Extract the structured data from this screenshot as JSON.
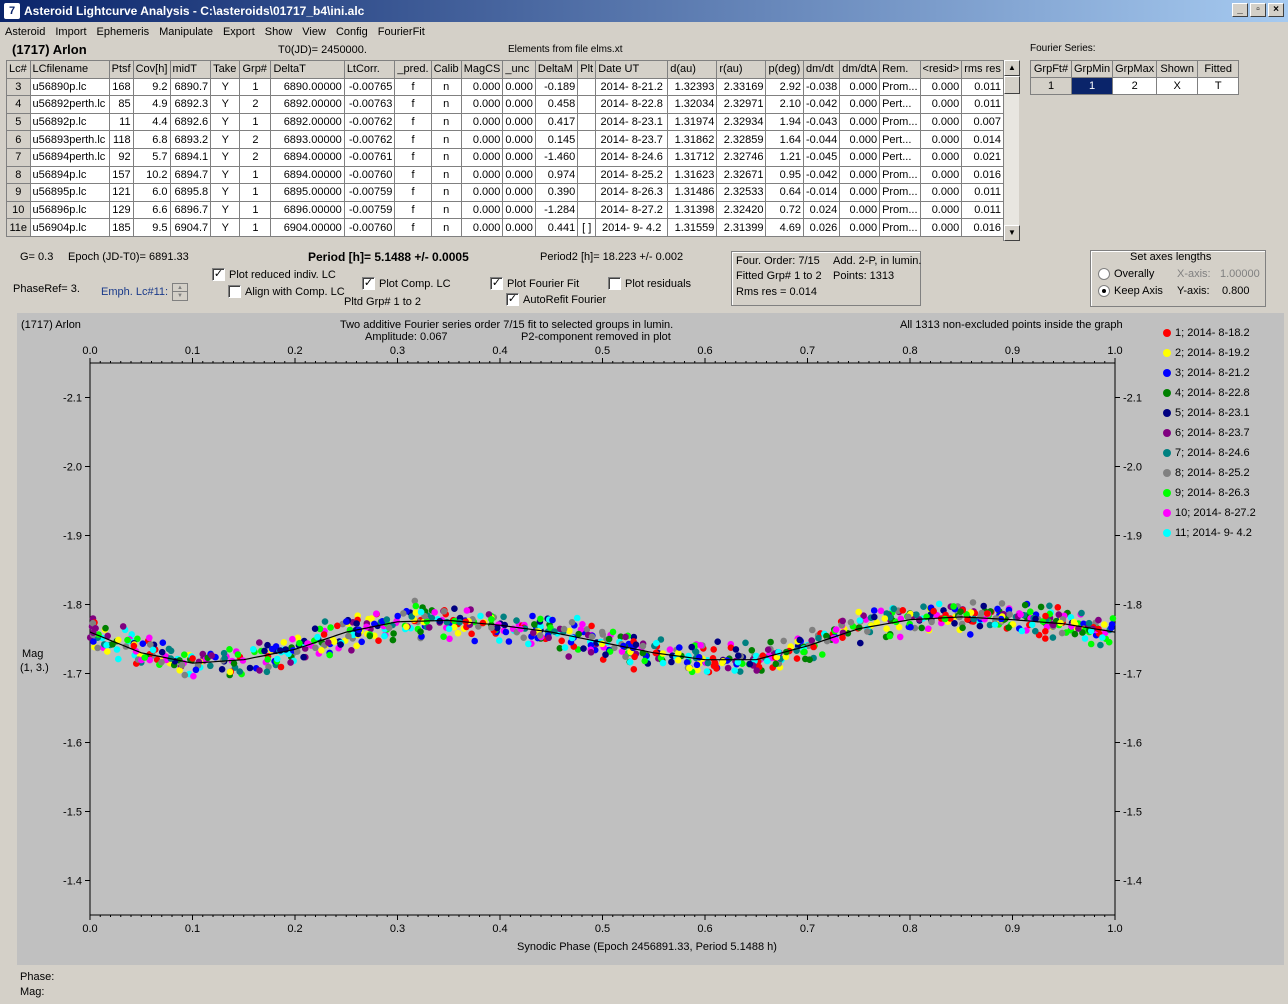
{
  "window": {
    "title": "Asteroid Lightcurve Analysis - C:\\asteroids\\01717_b4\\ini.alc",
    "icon_letter": "7"
  },
  "menu": [
    "Asteroid",
    "Import",
    "Ephemeris",
    "Manipulate",
    "Export",
    "Show",
    "View",
    "Config",
    "FourierFit"
  ],
  "header": {
    "asteroid": "(1717) Arlon",
    "t0": "T0(JD)= 2450000.",
    "elements": "Elements from file elms.xt",
    "fourier_title": "Fourier Series:"
  },
  "table": {
    "columns": [
      "Lc#",
      "LCfilename",
      "Ptsf",
      "Cov[h]",
      "midT",
      "Take",
      "Grp#",
      "DeltaT",
      "LtCorr.",
      "_pred.",
      "Calib",
      "MagCS",
      "_unc",
      "DeltaM",
      "Plt",
      "Date UT",
      "d(au)",
      "r(au)",
      "p(deg)",
      "dm/dt",
      "dm/dtA",
      "Rem.",
      "<resid>",
      "rms res"
    ],
    "rows": [
      [
        "3",
        "u56890p.lc",
        "168",
        "9.2",
        "6890.7",
        "Y",
        "1",
        "6890.00000",
        "-0.00765",
        "f",
        "n",
        "0.000",
        "0.000",
        "-0.189",
        "",
        "2014- 8-21.2",
        "1.32393",
        "2.33169",
        "2.92",
        "-0.038",
        "0.000",
        "Prom...",
        "0.000",
        "0.011"
      ],
      [
        "4",
        "u56892perth.lc",
        "85",
        "4.9",
        "6892.3",
        "Y",
        "2",
        "6892.00000",
        "-0.00763",
        "f",
        "n",
        "0.000",
        "0.000",
        "0.458",
        "",
        "2014- 8-22.8",
        "1.32034",
        "2.32971",
        "2.10",
        "-0.042",
        "0.000",
        "Pert...",
        "0.000",
        "0.011"
      ],
      [
        "5",
        "u56892p.lc",
        "11",
        "4.4",
        "6892.6",
        "Y",
        "1",
        "6892.00000",
        "-0.00762",
        "f",
        "n",
        "0.000",
        "0.000",
        "0.417",
        "",
        "2014- 8-23.1",
        "1.31974",
        "2.32934",
        "1.94",
        "-0.043",
        "0.000",
        "Prom...",
        "0.000",
        "0.007"
      ],
      [
        "6",
        "u56893perth.lc",
        "118",
        "6.8",
        "6893.2",
        "Y",
        "2",
        "6893.00000",
        "-0.00762",
        "f",
        "n",
        "0.000",
        "0.000",
        "0.145",
        "",
        "2014- 8-23.7",
        "1.31862",
        "2.32859",
        "1.64",
        "-0.044",
        "0.000",
        "Pert...",
        "0.000",
        "0.014"
      ],
      [
        "7",
        "u56894perth.lc",
        "92",
        "5.7",
        "6894.1",
        "Y",
        "2",
        "6894.00000",
        "-0.00761",
        "f",
        "n",
        "0.000",
        "0.000",
        "-1.460",
        "",
        "2014- 8-24.6",
        "1.31712",
        "2.32746",
        "1.21",
        "-0.045",
        "0.000",
        "Pert...",
        "0.000",
        "0.021"
      ],
      [
        "8",
        "u56894p.lc",
        "157",
        "10.2",
        "6894.7",
        "Y",
        "1",
        "6894.00000",
        "-0.00760",
        "f",
        "n",
        "0.000",
        "0.000",
        "0.974",
        "",
        "2014- 8-25.2",
        "1.31623",
        "2.32671",
        "0.95",
        "-0.042",
        "0.000",
        "Prom...",
        "0.000",
        "0.016"
      ],
      [
        "9",
        "u56895p.lc",
        "121",
        "6.0",
        "6895.8",
        "Y",
        "1",
        "6895.00000",
        "-0.00759",
        "f",
        "n",
        "0.000",
        "0.000",
        "0.390",
        "",
        "2014- 8-26.3",
        "1.31486",
        "2.32533",
        "0.64",
        "-0.014",
        "0.000",
        "Prom...",
        "0.000",
        "0.011"
      ],
      [
        "10",
        "u56896p.lc",
        "129",
        "6.6",
        "6896.7",
        "Y",
        "1",
        "6896.00000",
        "-0.00759",
        "f",
        "n",
        "0.000",
        "0.000",
        "-1.284",
        "",
        "2014- 8-27.2",
        "1.31398",
        "2.32420",
        "0.72",
        "0.024",
        "0.000",
        "Prom...",
        "0.000",
        "0.011"
      ],
      [
        "11e",
        "u56904p.lc",
        "185",
        "9.5",
        "6904.7",
        "Y",
        "1",
        "6904.00000",
        "-0.00760",
        "f",
        "n",
        "0.000",
        "0.000",
        "0.441",
        "[ ]",
        "2014- 9- 4.2",
        "1.31559",
        "2.31399",
        "4.69",
        "0.026",
        "0.000",
        "Prom...",
        "0.000",
        "0.016"
      ]
    ]
  },
  "fourier_table": {
    "columns": [
      "GrpFt#",
      "GrpMin",
      "GrpMax",
      "Shown",
      "Fitted"
    ],
    "row": [
      "1",
      "1",
      "2",
      "X",
      "T"
    ]
  },
  "controls": {
    "g": "G= 0.3",
    "epoch": "Epoch (JD-T0)= 6891.33",
    "period": "Period [h]= 5.1488 +/- 0.0005",
    "period2": "Period2 [h]= 18.223 +/- 0.002",
    "phaseref": "PhaseRef= 3.",
    "emph": "Emph. Lc#11:",
    "plot_reduced": "Plot reduced indiv. LC",
    "align_comp": "Align with Comp. LC",
    "plot_comp": "Plot Comp. LC",
    "pltd_grp": "Pltd Grp#  1   to   2",
    "plot_fourier": "Plot Fourier Fit",
    "autorefit": "AutoRefit Fourier",
    "plot_residuals": "Plot residuals",
    "info_order": "Four. Order:  7/15",
    "info_add": "Add. 2-P, in lumin.",
    "info_fitted": "Fitted Grp# 1 to 2",
    "info_points": "Points: 1313",
    "info_rms": "Rms res     = 0.014",
    "axes_title": "Set axes lengths",
    "overally": "Overally",
    "keep_axis": "Keep Axis",
    "xaxis_label": "X-axis:",
    "xaxis_val": "1.00000",
    "yaxis_label": "Y-axis:",
    "yaxis_val": "0.800"
  },
  "status": {
    "phase": "Phase:",
    "mag": "Mag:"
  },
  "chart_data": {
    "type": "scatter",
    "object_label": "(1717) Arlon",
    "title": "Two additive Fourier series order 7/15 fit to selected groups in lumin.",
    "amplitude": "Amplitude: 0.067",
    "p2_note": "P2-component removed in plot",
    "points_note": "All 1313 non-excluded points inside the graph",
    "xlabel": "Synodic Phase (Epoch 2456891.33, Period 5.1488 h)",
    "ylabel": "Mag",
    "ylabel2": "(1, 3.)",
    "xlim": [
      0.0,
      1.0
    ],
    "ylim": [
      -2.15,
      -1.35
    ],
    "y_inverted": true,
    "x_ticks": [
      "0.0",
      "0.1",
      "0.2",
      "0.3",
      "0.4",
      "0.5",
      "0.6",
      "0.7",
      "0.8",
      "0.9",
      "1.0"
    ],
    "y_ticks": [
      "-2.1",
      "-2.0",
      "-1.9",
      "-1.8",
      "-1.7",
      "-1.6",
      "-1.5",
      "-1.4"
    ],
    "y_tick_values": [
      -2.1,
      -2.0,
      -1.9,
      -1.8,
      -1.7,
      -1.6,
      -1.5,
      -1.4
    ],
    "fit_curve": {
      "x": [
        0.0,
        0.05,
        0.1,
        0.15,
        0.2,
        0.25,
        0.3,
        0.35,
        0.4,
        0.45,
        0.5,
        0.55,
        0.6,
        0.65,
        0.7,
        0.75,
        0.8,
        0.85,
        0.9,
        0.95,
        1.0
      ],
      "y": [
        -1.76,
        -1.73,
        -1.715,
        -1.72,
        -1.735,
        -1.76,
        -1.775,
        -1.777,
        -1.77,
        -1.76,
        -1.745,
        -1.73,
        -1.72,
        -1.72,
        -1.74,
        -1.765,
        -1.778,
        -1.782,
        -1.778,
        -1.772,
        -1.76
      ]
    },
    "series": [
      {
        "name": "1; 2014- 8-18.2",
        "color": "#ff0000"
      },
      {
        "name": "2; 2014- 8-19.2",
        "color": "#ffff00"
      },
      {
        "name": "3; 2014- 8-21.2",
        "color": "#0000ff"
      },
      {
        "name": "4; 2014- 8-22.8",
        "color": "#008000"
      },
      {
        "name": "5; 2014- 8-23.1",
        "color": "#000080"
      },
      {
        "name": "6; 2014- 8-23.7",
        "color": "#800080"
      },
      {
        "name": "7; 2014- 8-24.6",
        "color": "#008080"
      },
      {
        "name": "8; 2014- 8-25.2",
        "color": "#808080"
      },
      {
        "name": "9; 2014- 8-26.3",
        "color": "#00ff00"
      },
      {
        "name": "10; 2014- 8-27.2",
        "color": "#ff00ff"
      },
      {
        "name": "11; 2014- 9- 4.2",
        "color": "#00ffff"
      }
    ],
    "grid": false,
    "legend_position": "right"
  }
}
